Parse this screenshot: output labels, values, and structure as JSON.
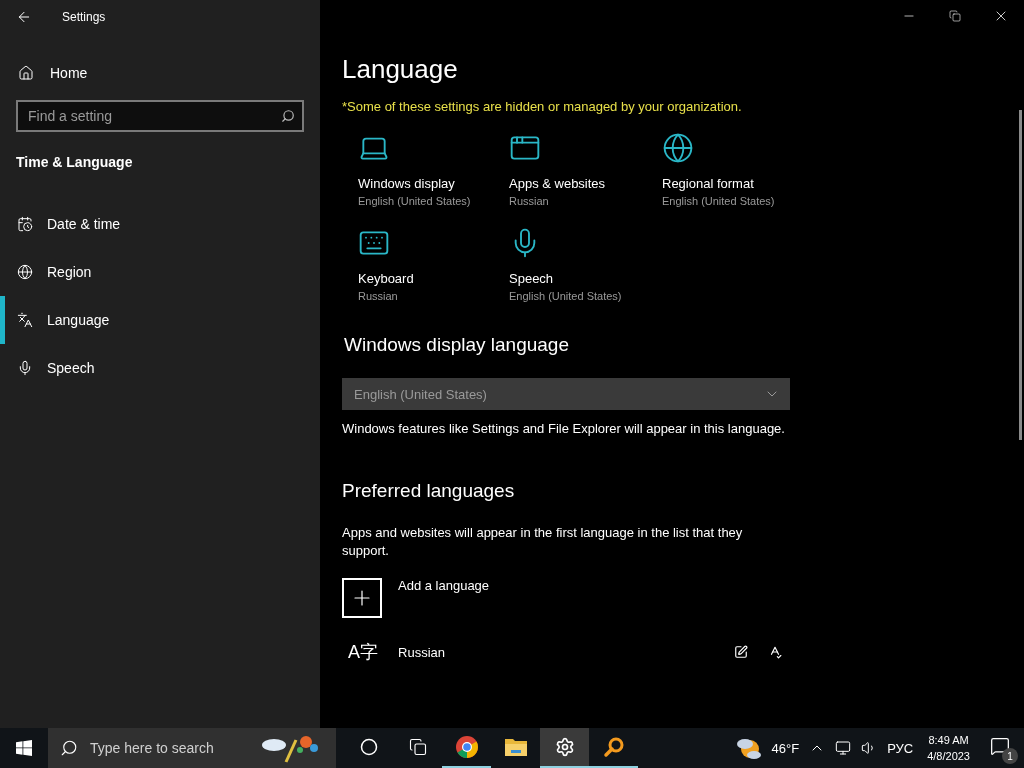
{
  "window": {
    "title": "Settings"
  },
  "sidebar": {
    "home": "Home",
    "search": {
      "placeholder": "Find a setting"
    },
    "section": "Time & Language",
    "items": [
      {
        "kind": "date",
        "label": "Date & time",
        "selected": false
      },
      {
        "kind": "region",
        "label": "Region",
        "selected": false
      },
      {
        "kind": "language",
        "label": "Language",
        "selected": true
      },
      {
        "kind": "speech",
        "label": "Speech",
        "selected": false
      }
    ]
  },
  "main": {
    "title": "Language",
    "notice": "*Some of these settings are hidden or managed by your organization.",
    "tiles": [
      {
        "kind": "display",
        "label": "Windows display",
        "value": "English (United States)"
      },
      {
        "kind": "apps",
        "label": "Apps & websites",
        "value": "Russian"
      },
      {
        "kind": "region",
        "label": "Regional format",
        "value": "English (United States)"
      },
      {
        "kind": "keyboard",
        "label": "Keyboard",
        "value": "Russian"
      },
      {
        "kind": "speech",
        "label": "Speech",
        "value": "English (United States)"
      }
    ],
    "display_language": {
      "heading": "Windows display language",
      "dropdown": {
        "value": "English (United States)",
        "disabled": true
      },
      "description": "Windows features like Settings and File Explorer will appear in this language."
    },
    "preferred": {
      "heading": "Preferred languages",
      "description": "Apps and websites will appear in the first language in the list that they support.",
      "add_button": "Add a language",
      "languages": [
        {
          "glyph": "A字",
          "name": "Russian"
        }
      ]
    }
  },
  "taskbar": {
    "search": {
      "placeholder": "Type here to search"
    },
    "apps": [
      {
        "kind": "cortana",
        "running": false,
        "selected": false
      },
      {
        "kind": "taskview",
        "running": false,
        "selected": false
      },
      {
        "kind": "chrome",
        "running": true,
        "selected": false
      },
      {
        "kind": "explorer",
        "running": false,
        "selected": false
      },
      {
        "kind": "settings",
        "running": true,
        "selected": true
      },
      {
        "kind": "magnifier",
        "running": true,
        "selected": false
      }
    ],
    "weather": "46°F",
    "input_language": "РУС",
    "time": "8:49 AM",
    "date": "4/8/2023",
    "notifications": "1"
  }
}
